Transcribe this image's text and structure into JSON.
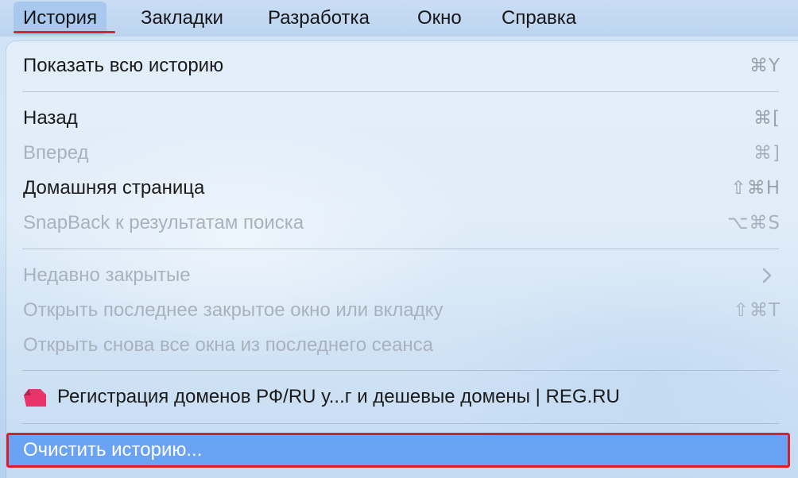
{
  "menubar": {
    "items": [
      {
        "label": "История",
        "active": true
      },
      {
        "label": "Закладки"
      },
      {
        "label": "Разработка"
      },
      {
        "label": "Окно"
      },
      {
        "label": "Справка"
      }
    ]
  },
  "menu": {
    "show_all_history": {
      "label": "Показать всю историю",
      "shortcut": "⌘Y"
    },
    "back": {
      "label": "Назад",
      "shortcut": "⌘["
    },
    "forward": {
      "label": "Вперед",
      "shortcut": "⌘]"
    },
    "home_page": {
      "label": "Домашняя страница",
      "shortcut": "⇧⌘H"
    },
    "snapback": {
      "label": "SnapBack к результатам поиска",
      "shortcut": "⌥⌘S"
    },
    "recently_closed": {
      "label": "Недавно закрытые"
    },
    "reopen_last_closed": {
      "label": "Открыть последнее закрытое окно или вкладку",
      "shortcut": "⇧⌘T"
    },
    "reopen_all_windows": {
      "label": "Открыть снова все окна из последнего сеанса"
    },
    "history_entry": {
      "label": "Регистрация доменов РФ/RU у...г и дешевые домены | REG.RU",
      "favicon": "reg-ru-favicon"
    },
    "clear_history": {
      "label": "Очистить историю..."
    }
  },
  "colors": {
    "highlight": "#6aa2f4",
    "annotation_red": "#d8202a",
    "favicon_pink": "#e8336b"
  }
}
